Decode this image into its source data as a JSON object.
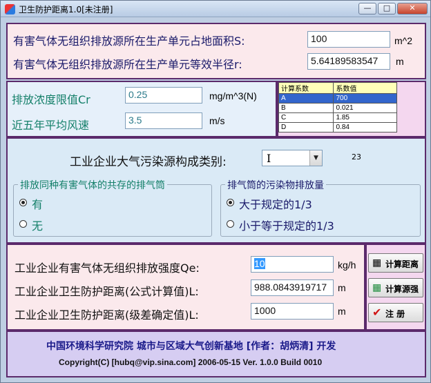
{
  "window": {
    "title": "卫生防护距离1.0[未注册]",
    "min": "—",
    "max": "□",
    "close": "✕"
  },
  "area": {
    "label_s": "有害气体无组织排放源所在生产单元占地面积S:",
    "value_s": "100",
    "unit_s": "m^2",
    "label_r": "有害气体无组织排放源所在生产单元等效半径r:",
    "value_r": "5.64189583547",
    "unit_r": "m"
  },
  "conc": {
    "label_cr": "排放浓度限值Cr",
    "value_cr": "0.25",
    "unit_cr": "mg/m^3(N)",
    "label_wind": "近五年平均风速",
    "value_wind": "3.5",
    "unit_wind": "m/s"
  },
  "coef_table": {
    "headers": [
      "计算系数",
      "系数值"
    ],
    "rows": [
      {
        "k": "A",
        "v": "700"
      },
      {
        "k": "B",
        "v": "0.021"
      },
      {
        "k": "C",
        "v": "1.85"
      },
      {
        "k": "D",
        "v": "0.84"
      }
    ]
  },
  "source": {
    "label": "工业企业大气污染源构成类别:",
    "selected": "I",
    "code": "23"
  },
  "group_coexist": {
    "title": "排放同种有害气体的共存的排气筒",
    "opt_yes": "有",
    "opt_no": "无"
  },
  "group_emission": {
    "title": "排气筒的污染物排放量",
    "opt_more": "大于规定的1/3",
    "opt_less": "小于等于规定的1/3"
  },
  "results": {
    "label_qe": "工业企业有害气体无组织排放强度Qe:",
    "value_qe": "10",
    "unit_qe": "kg/h",
    "label_l1": "工业企业卫生防护距离(公式计算值)L:",
    "value_l1": "988.0843919717",
    "unit_l1": "m",
    "label_l2": "工业企业卫生防护距离(级差确定值)L:",
    "value_l2": "1000",
    "unit_l2": "m"
  },
  "buttons": {
    "calc_distance": "计算距离",
    "calc_source": "计算源强",
    "register": "注   册"
  },
  "footer": {
    "line1": "中国环境科学研究院 城市与区域大气创新基地 [作者：胡炳清] 开发",
    "line2": "Copyright(C) [hubq@vip.sina.com] 2006-05-15 Ver. 1.0.0 Build 0010"
  }
}
